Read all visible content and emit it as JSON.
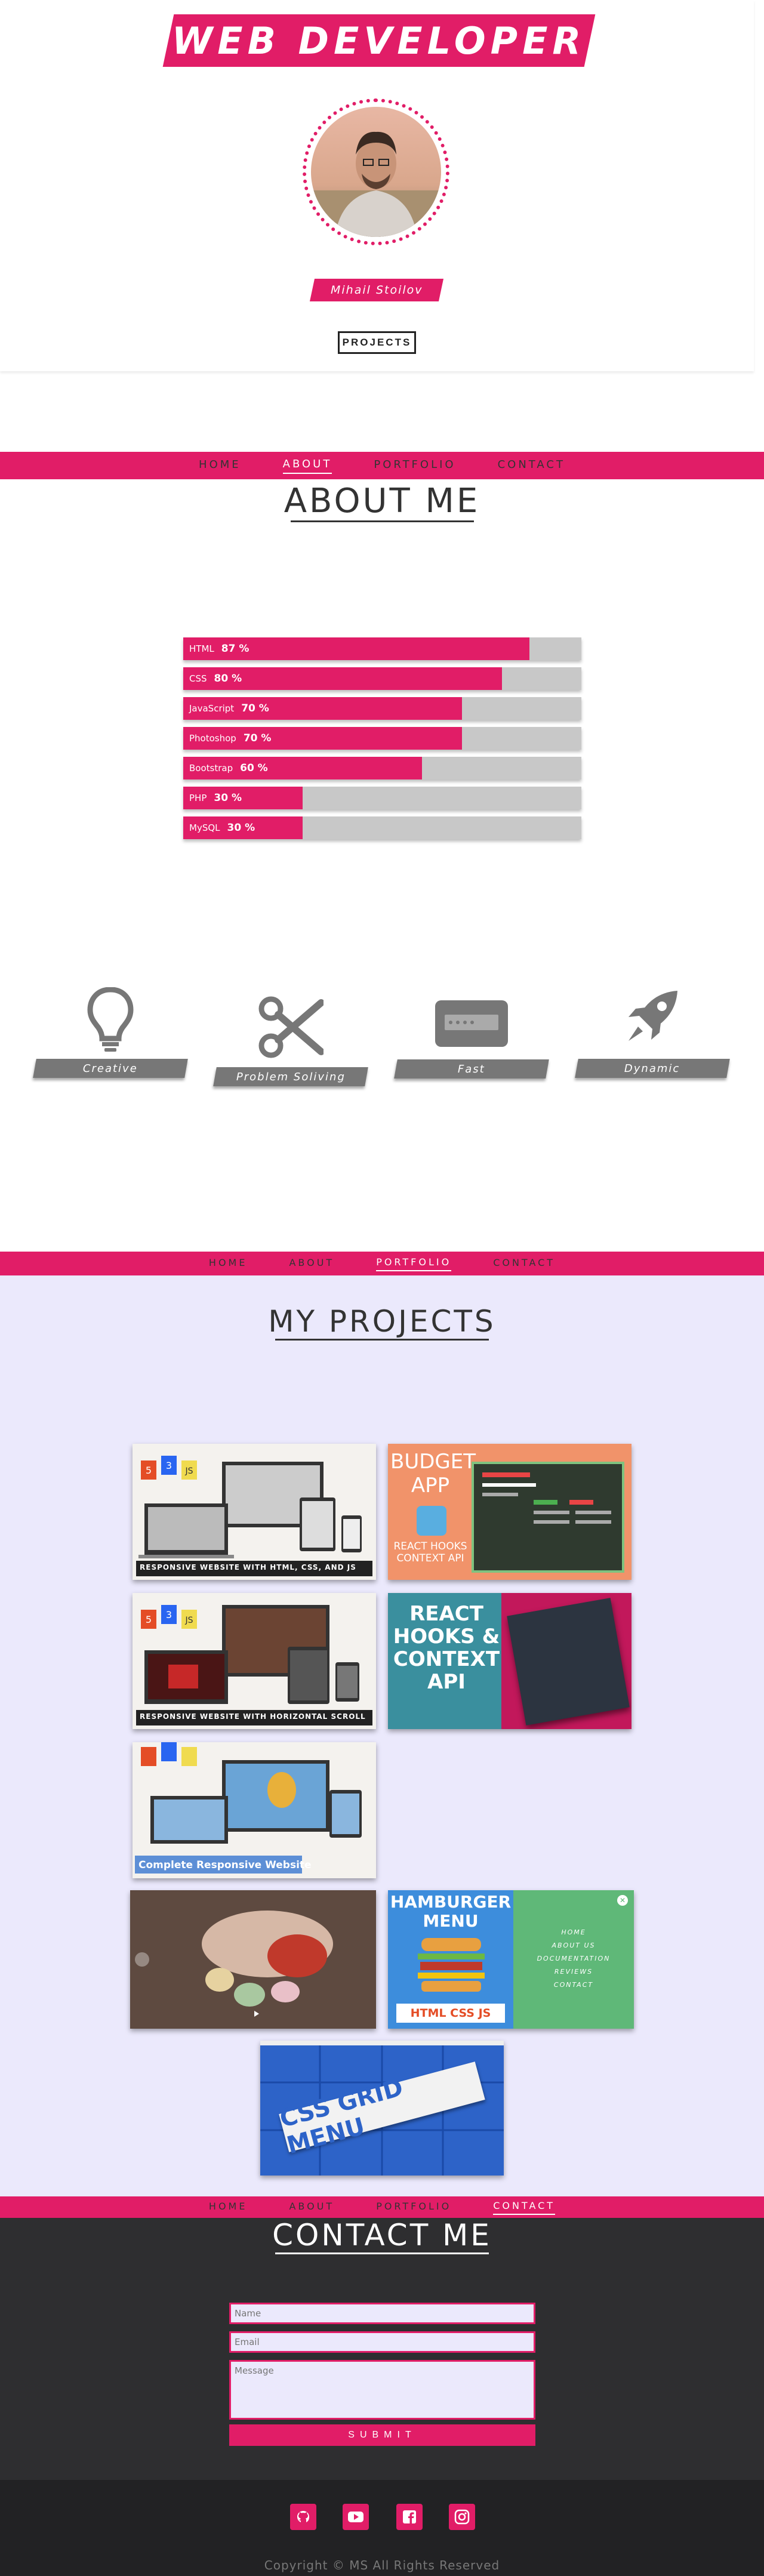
{
  "hero": {
    "title": "WEB DEVELOPER",
    "name": "Mihail Stoilov",
    "projects_button": "PROJECTS"
  },
  "nav": {
    "items": [
      "HOME",
      "ABOUT",
      "PORTFOLIO",
      "CONTACT"
    ]
  },
  "about": {
    "title": "ABOUT ME",
    "skills": [
      {
        "name": "HTML",
        "value_label": "87 %",
        "value": 87
      },
      {
        "name": "CSS",
        "value_label": "80 %",
        "value": 80
      },
      {
        "name": "JavaScript",
        "value_label": "70 %",
        "value": 70
      },
      {
        "name": "Photoshop",
        "value_label": "70 %",
        "value": 70
      },
      {
        "name": "Bootstrap",
        "value_label": "60 %",
        "value": 60
      },
      {
        "name": "PHP",
        "value_label": "30 %",
        "value": 30
      },
      {
        "name": "MySQL",
        "value_label": "30 %",
        "value": 30
      }
    ],
    "traits": [
      {
        "label": "Creative",
        "icon": "lightbulb-icon"
      },
      {
        "label": "Problem Soliving",
        "icon": "scissors-icon"
      },
      {
        "label": "Fast",
        "icon": "card-icon"
      },
      {
        "label": "Dynamic",
        "icon": "rocket-icon"
      }
    ]
  },
  "portfolio": {
    "title": "MY PROJECTS",
    "projects": {
      "p1_caption": "RESPONSIVE WEBSITE WITH HTML, CSS, AND JS",
      "p2_title": "BUDGET APP",
      "p2_sub": "REACT HOOKS CONTEXT API",
      "p3_caption": "RESPONSIVE WEBSITE WITH HORIZONTAL SCROLL",
      "p4_title": "REACT HOOKS & CONTEXT API",
      "p5_caption": "Complete Responsive Website",
      "p7_title": "HAMBURGER MENU",
      "p7_tags": "HTML CSS JS",
      "p7_menu": [
        "HOME",
        "ABOUT US",
        "DOCUMENTATION",
        "REVIEWS",
        "CONTACT"
      ],
      "p8_title": "CSS GRID MENU"
    }
  },
  "contact": {
    "title": "CONTACT ME",
    "name_placeholder": "Name",
    "email_placeholder": "Email",
    "message_placeholder": "Message",
    "submit": "SUBMIT"
  },
  "footer": {
    "copyright": "Copyright © MS All Rights Reserved",
    "social": [
      "github-icon",
      "youtube-icon",
      "facebook-icon",
      "instagram-icon"
    ]
  },
  "colors": {
    "accent": "#e11d67",
    "dark": "#2e2e30",
    "lavender": "#ebe9fc"
  }
}
